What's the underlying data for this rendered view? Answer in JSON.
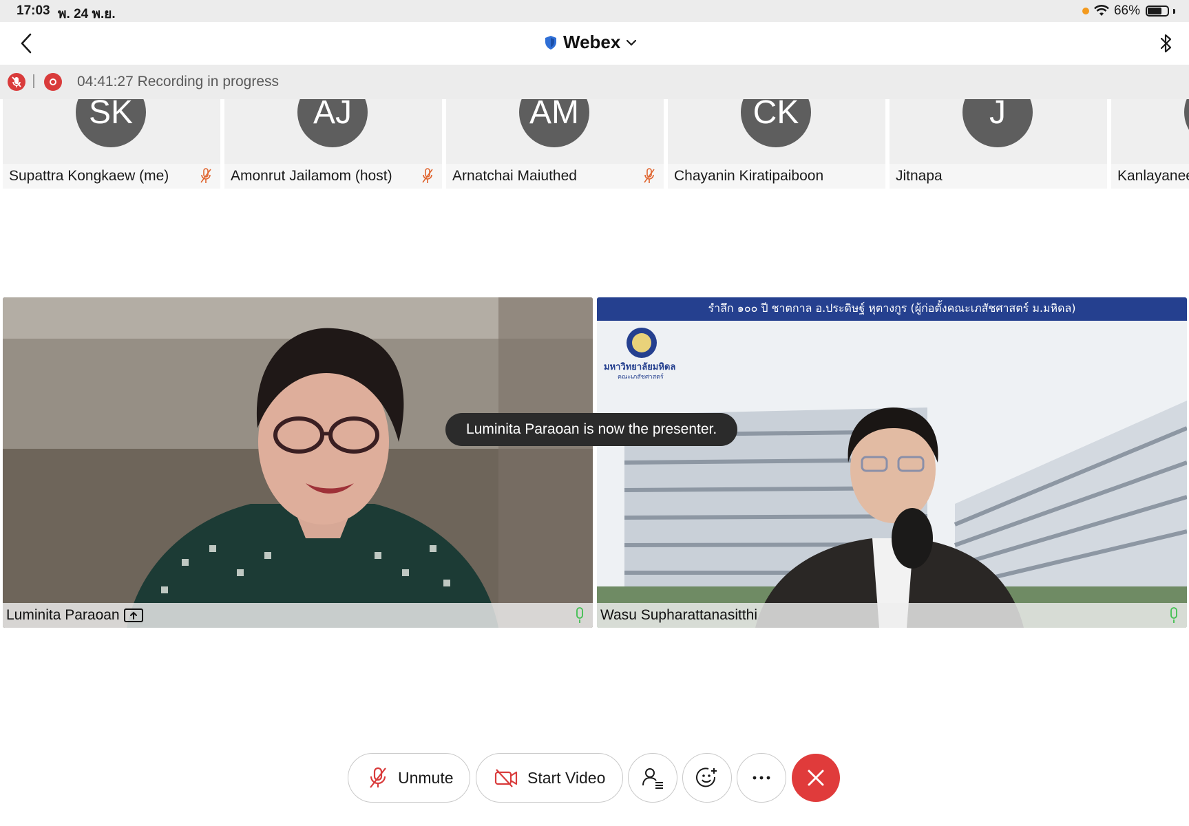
{
  "status_bar": {
    "time": "17:03",
    "date": "พ. 24 พ.ย.",
    "battery": "66%",
    "battery_level": 0.66
  },
  "nav": {
    "title": "Webex"
  },
  "recording": {
    "text": "04:41:27 Recording in progress"
  },
  "participants": [
    {
      "initials": "SK",
      "name": "Supattra Kongkaew (me)",
      "muted": true
    },
    {
      "initials": "AJ",
      "name": "Amonrut Jailamom (host)",
      "muted": true
    },
    {
      "initials": "AM",
      "name": "Arnatchai Maiuthed",
      "muted": true
    },
    {
      "initials": "CK",
      "name": "Chayanin Kiratipaiboon",
      "muted": false
    },
    {
      "initials": "J",
      "name": "Jitnapa",
      "muted": false
    },
    {
      "initials": "",
      "name": "Kanlayanee",
      "muted": false
    }
  ],
  "videos": {
    "left": {
      "name": "Luminita Paraoan"
    },
    "right": {
      "name": "Wasu Supharattanasitthi",
      "banner": "รำลึก ๑๐๐ ปี ชาตกาล อ.ประดิษฐ์ หุตางกูร (ผู้ก่อตั้งคณะเภสัชศาสตร์ ม.มหิดล)",
      "logo_text": "มหาวิทยาลัยมหิดล",
      "logo_subtext": "คณะเภสัชศาสตร์"
    }
  },
  "toast": {
    "text": "Luminita Paraoan is now the presenter."
  },
  "controls": {
    "unmute": "Unmute",
    "start_video": "Start Video"
  },
  "colors": {
    "danger": "#e03b3b",
    "mic_active": "#3fbf4f",
    "mute_orange": "#e0642e",
    "banner_blue": "#25408f"
  },
  "icons": [
    "back-icon",
    "shield-icon",
    "chevron-down-icon",
    "bluetooth-icon",
    "wifi-icon",
    "battery-icon",
    "mic-muted-icon",
    "record-icon",
    "share-icon",
    "mic-icon",
    "video-off-icon",
    "participants-icon",
    "reaction-icon",
    "more-icon",
    "close-icon"
  ]
}
